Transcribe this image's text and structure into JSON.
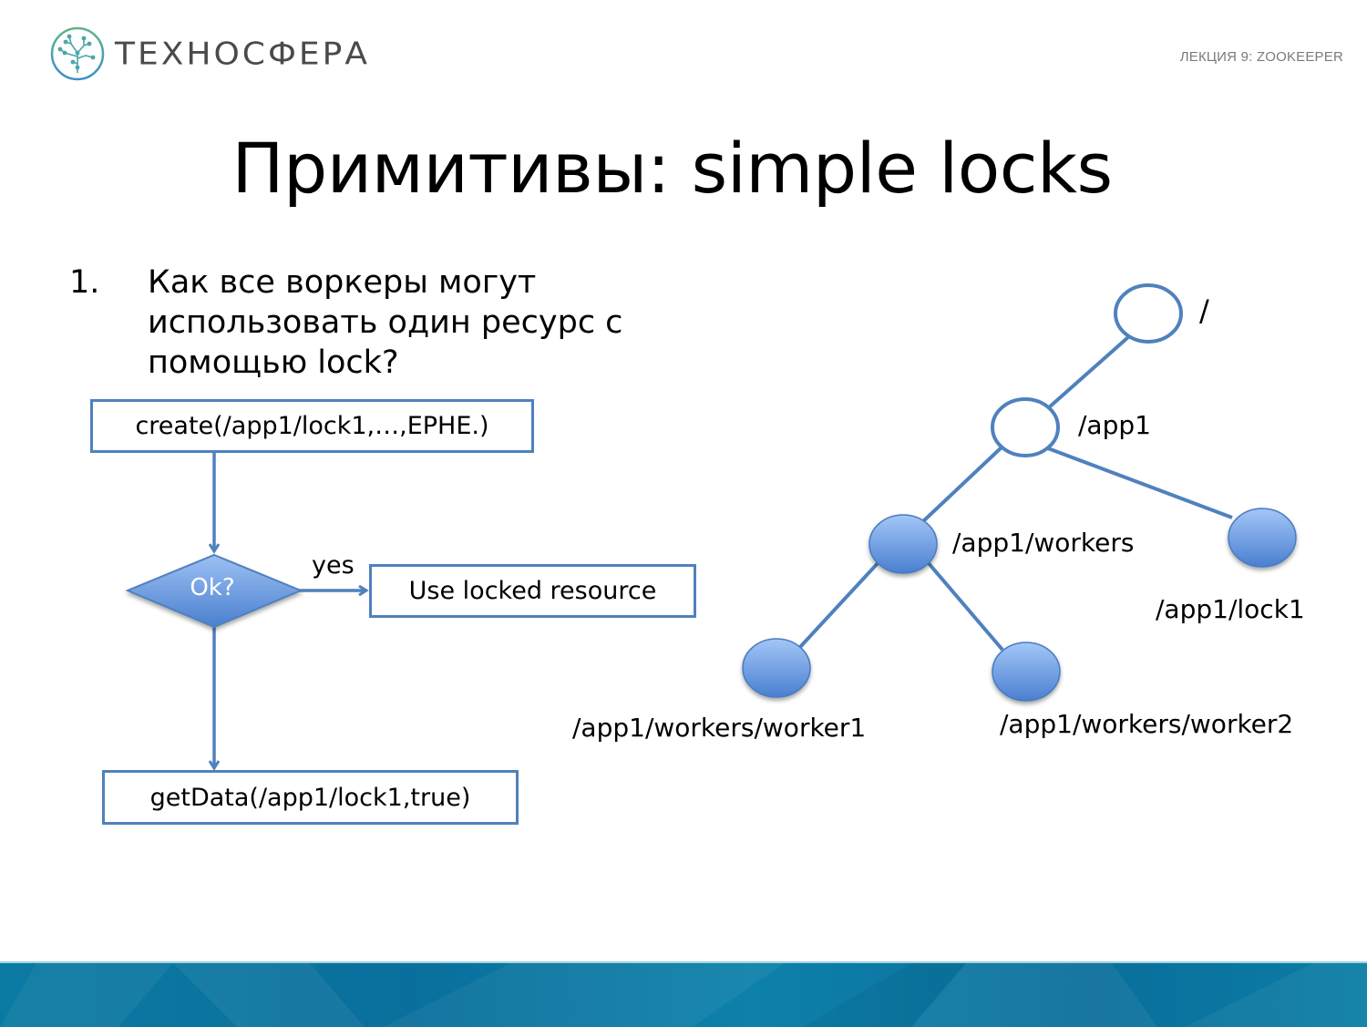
{
  "header": {
    "logo_text": "ТЕХНОСФЕРА",
    "logo_icon": "tree-circle-icon",
    "lecture_label": "ЛЕКЦИЯ 9: ZOOKEEPER"
  },
  "slide": {
    "title": "Примитивы: simple locks",
    "bullets": [
      {
        "number": "1.",
        "text": "Как все воркеры могут использовать один ресурс с помощью lock?"
      }
    ]
  },
  "flowchart": {
    "create_box": "create(/app1/lock1,…,EPHE.)",
    "decision": "Ok?",
    "yes_label": "yes",
    "use_box": "Use locked resource",
    "getdata_box": "getData(/app1/lock1,true)"
  },
  "tree": {
    "nodes": [
      {
        "id": "root",
        "label": "/",
        "style": "hollow"
      },
      {
        "id": "app1",
        "label": "/app1",
        "style": "hollow"
      },
      {
        "id": "workers",
        "label": "/app1/workers",
        "style": "filled"
      },
      {
        "id": "lock1",
        "label": "/app1/lock1",
        "style": "filled"
      },
      {
        "id": "worker1",
        "label": "/app1/workers/worker1",
        "style": "filled"
      },
      {
        "id": "worker2",
        "label": "/app1/workers/worker2",
        "style": "filled"
      }
    ],
    "edges": [
      [
        "root",
        "app1"
      ],
      [
        "app1",
        "workers"
      ],
      [
        "app1",
        "lock1"
      ],
      [
        "workers",
        "worker1"
      ],
      [
        "workers",
        "worker2"
      ]
    ]
  },
  "colors": {
    "accent": "#4f81bd",
    "node_fill_top": "#9dc3f5",
    "node_fill_bottom": "#4a7fd0",
    "footer": "#0b78a2"
  }
}
